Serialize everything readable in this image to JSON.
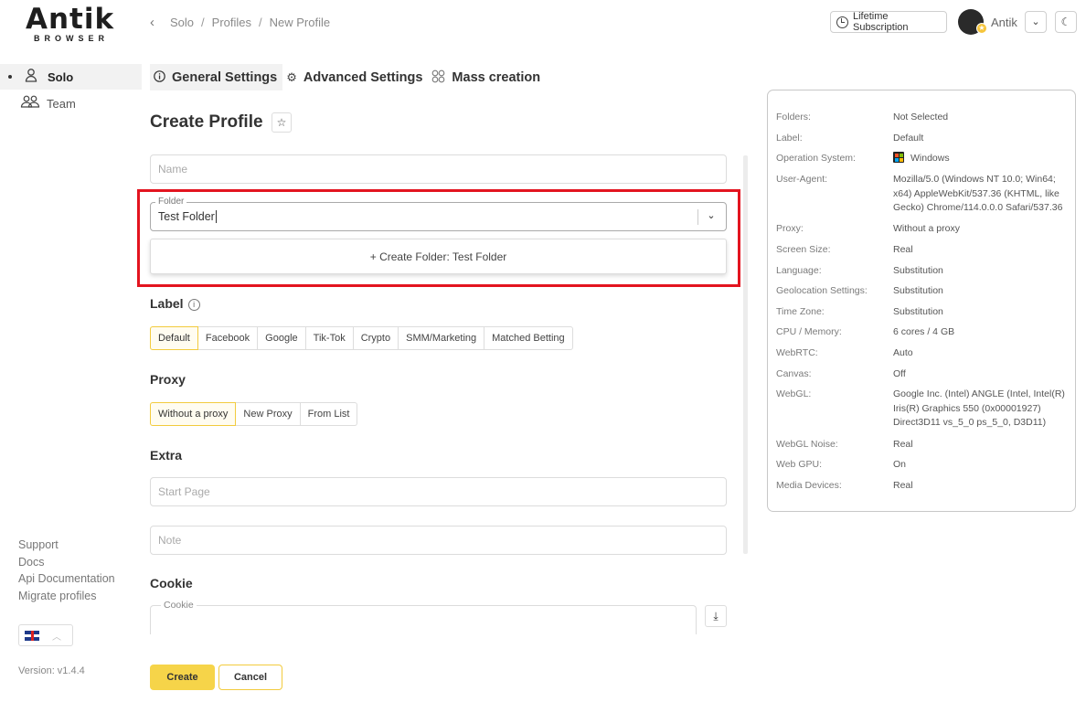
{
  "logo": {
    "main": "Antik",
    "sub": "BROWSER"
  },
  "breadcrumb": {
    "back": "‹",
    "items": [
      "Solo",
      "Profiles",
      "New Profile"
    ],
    "sep": "/"
  },
  "header": {
    "subscription": "Lifetime Subscription",
    "user": "Antik",
    "chevron": "⌄",
    "theme": "☾"
  },
  "sidebar": {
    "items": [
      {
        "label": "Solo",
        "icon": "user-icon"
      },
      {
        "label": "Team",
        "icon": "team-icon"
      }
    ],
    "links": [
      "Support",
      "Docs",
      "Api Documentation",
      "Migrate profiles"
    ],
    "version": "Version: v1.4.4",
    "lang_toggle": "︿"
  },
  "tabs": [
    {
      "label": "General Settings",
      "icon": "info-icon"
    },
    {
      "label": "Advanced Settings",
      "icon": "gear-icon"
    },
    {
      "label": "Mass creation",
      "icon": "grid-icon"
    }
  ],
  "form": {
    "title": "Create Profile",
    "star": "☆",
    "name_placeholder": "Name",
    "folder_label": "Folder",
    "folder_value": "Test Folder",
    "folder_chevron": "⌄",
    "create_folder": "+ Create Folder: Test Folder",
    "label_title": "Label",
    "info": "i",
    "labels": [
      "Default",
      "Facebook",
      "Google",
      "Tik-Tok",
      "Crypto",
      "SMM/Marketing",
      "Matched Betting"
    ],
    "selected_label": "Default",
    "proxy_title": "Proxy",
    "proxy_options": [
      "Without a proxy",
      "New Proxy",
      "From List"
    ],
    "selected_proxy": "Without a proxy",
    "extra_title": "Extra",
    "start_page_placeholder": "Start Page",
    "note_placeholder": "Note",
    "cookie_title": "Cookie",
    "cookie_label": "Cookie",
    "download": "⤓",
    "create": "Create",
    "cancel": "Cancel"
  },
  "summary": [
    {
      "label": "Folders:",
      "value": "Not Selected"
    },
    {
      "label": "Label:",
      "value": "Default"
    },
    {
      "label": "Operation System:",
      "value": "Windows",
      "icon": "windows-icon"
    },
    {
      "label": "User-Agent:",
      "value": "Mozilla/5.0 (Windows NT 10.0; Win64; x64) AppleWebKit/537.36 (KHTML, like Gecko) Chrome/114.0.0.0 Safari/537.36"
    },
    {
      "label": "Proxy:",
      "value": "Without a proxy"
    },
    {
      "label": "Screen Size:",
      "value": "Real"
    },
    {
      "label": "Language:",
      "value": "Substitution"
    },
    {
      "label": "Geolocation Settings:",
      "value": "Substitution"
    },
    {
      "label": "Time Zone:",
      "value": "Substitution"
    },
    {
      "label": "CPU / Memory:",
      "value": "6 cores / 4 GB"
    },
    {
      "label": "WebRTC:",
      "value": "Auto"
    },
    {
      "label": "Canvas:",
      "value": "Off"
    },
    {
      "label": "WebGL:",
      "value": "Google Inc. (Intel) ANGLE (Intel, Intel(R) Iris(R) Graphics 550 (0x00001927) Direct3D11 vs_5_0 ps_5_0, D3D11)"
    },
    {
      "label": "WebGL Noise:",
      "value": "Real"
    },
    {
      "label": "Web GPU:",
      "value": "On"
    },
    {
      "label": "Media Devices:",
      "value": "Real"
    }
  ],
  "colors": {
    "accent": "#f6d449",
    "highlight": "#e3141f"
  }
}
